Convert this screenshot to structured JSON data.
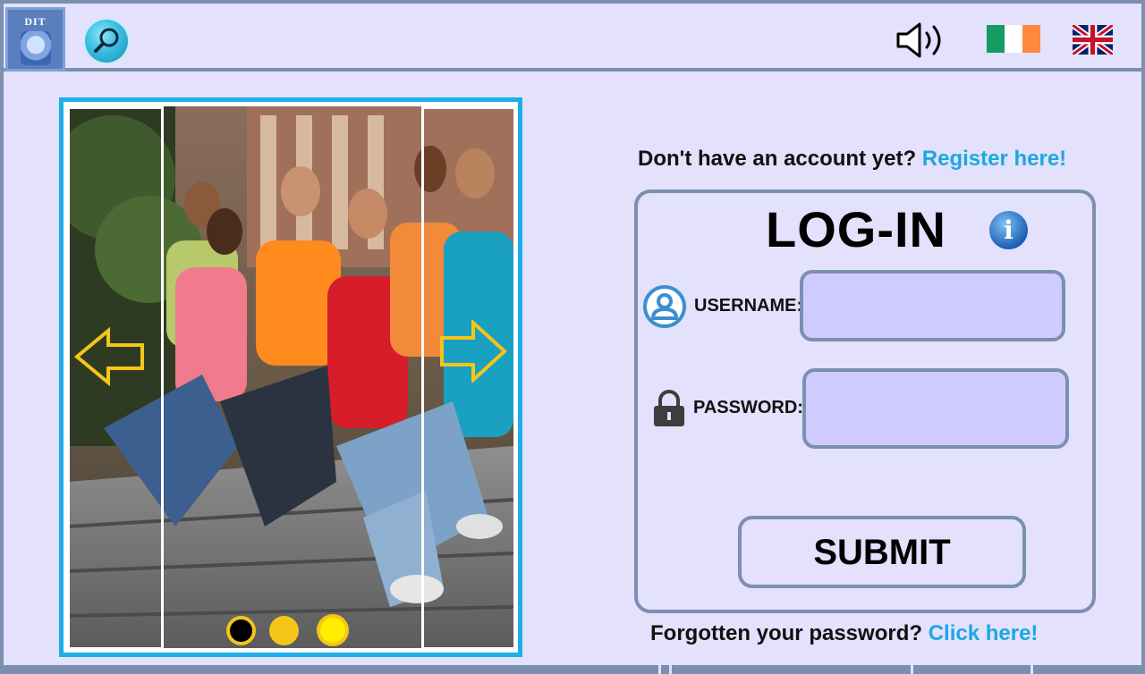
{
  "header": {
    "logo_text": "DIT",
    "search_icon": "search-icon",
    "sound_icon": "speaker-icon",
    "flags": [
      "ireland-flag-icon",
      "uk-flag-icon"
    ]
  },
  "slider": {
    "prev_icon": "arrow-left-icon",
    "next_icon": "arrow-right-icon",
    "dots": 3,
    "active_dot": 1
  },
  "register": {
    "prompt": "Don't have an account yet?",
    "link": "Register here!"
  },
  "login": {
    "title": "LOG-IN",
    "info_icon": "i",
    "username_label": "USERNAME:",
    "username_value": "",
    "password_label": "PASSWORD:",
    "password_value": "",
    "submit_label": "SUBMIT"
  },
  "forgot": {
    "prompt": "Forgotten your password?",
    "link": "Click here!"
  },
  "colors": {
    "background": "#e3e1fb",
    "frame": "#7b8fb0",
    "link": "#1ca8e0",
    "input_fill": "#d0cbfe",
    "slider_border": "#1eaee8",
    "arrow": "#f5c518"
  }
}
